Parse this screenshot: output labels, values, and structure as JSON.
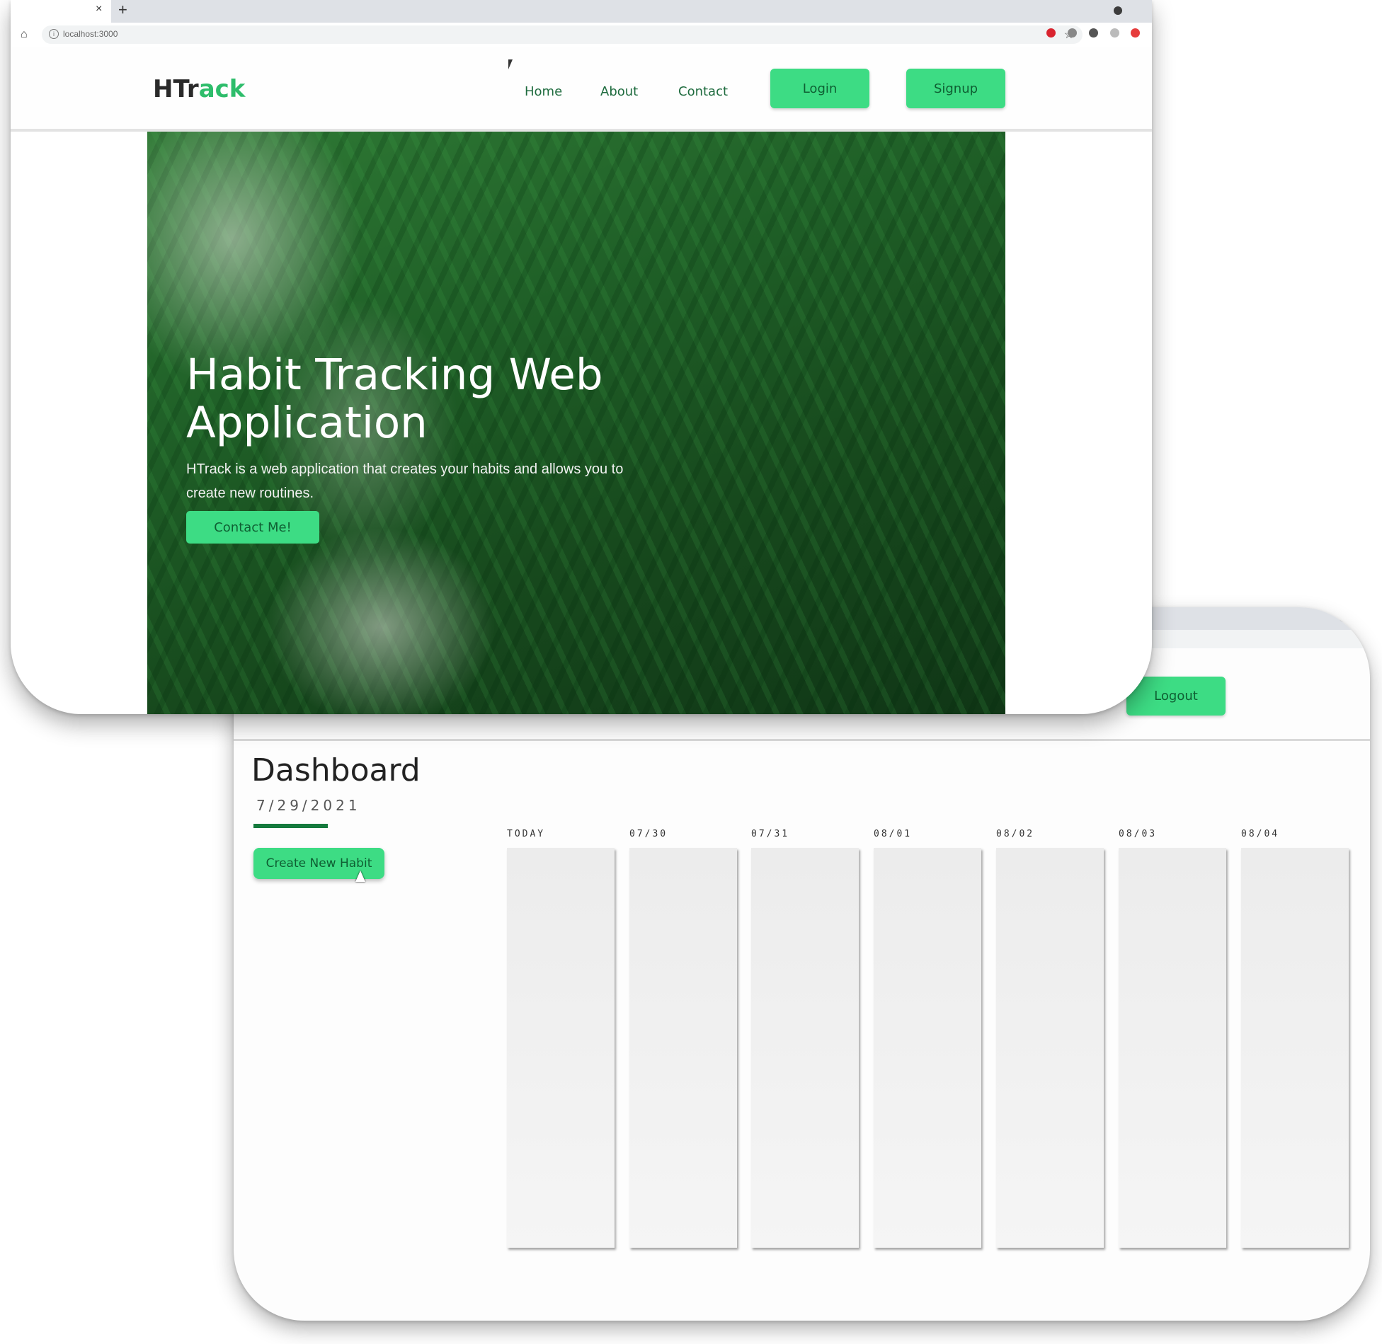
{
  "landing": {
    "tab": {
      "close_glyph": "×",
      "new_glyph": "+"
    },
    "url": "localhost:3000",
    "logo": {
      "part_a": "HTr",
      "part_b": "ack"
    },
    "nav": [
      {
        "label": "Home"
      },
      {
        "label": "About"
      },
      {
        "label": "Contact"
      }
    ],
    "login_label": "Login",
    "signup_label": "Signup",
    "hero": {
      "title": "Habit Tracking Web Application",
      "text": "HTrack is a web application that creates your habits and allows you to create new routines.",
      "cta_label": "Contact Me!"
    },
    "icons": {
      "home": "home-icon",
      "info": "info-icon",
      "star": "star-icon",
      "close": "close-icon",
      "new_tab": "plus-icon"
    },
    "colors": {
      "accent": "#3ddc84",
      "accent_text": "#0f5f33",
      "logo_green": "#2ebd6b"
    }
  },
  "dashboard": {
    "logout_label": "Logout",
    "title": "Dashboard",
    "date": "7/29/2021",
    "create_label": "Create New Habit",
    "days": [
      {
        "label": "TODAY"
      },
      {
        "label": "07/30"
      },
      {
        "label": "07/31"
      },
      {
        "label": "08/01"
      },
      {
        "label": "08/02"
      },
      {
        "label": "08/03"
      },
      {
        "label": "08/04"
      }
    ],
    "colors": {
      "underline": "#157a3d"
    }
  }
}
